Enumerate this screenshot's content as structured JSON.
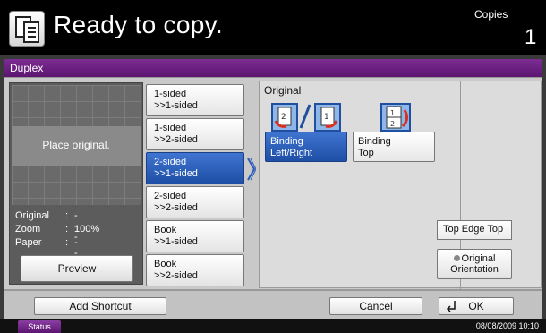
{
  "header": {
    "title": "Ready to copy.",
    "copies_label": "Copies",
    "copies_value": "1",
    "icon": "copy-document-icon"
  },
  "function_bar": {
    "title": "Duplex"
  },
  "preview": {
    "placeholder": "Place original.",
    "original_label": "Original",
    "original_value": "---",
    "zoom_label": "Zoom",
    "zoom_value": "100%",
    "paper_label": "Paper",
    "paper_value": "---",
    "separator": ":",
    "button": "Preview"
  },
  "duplex_options": [
    {
      "label": "1-sided\n>>1-sided",
      "selected": false
    },
    {
      "label": "1-sided\n>>2-sided",
      "selected": false
    },
    {
      "label": "2-sided\n>>1-sided",
      "selected": true
    },
    {
      "label": "2-sided\n>>2-sided",
      "selected": false
    },
    {
      "label": "Book\n>>1-sided",
      "selected": false
    },
    {
      "label": "Book\n>>2-sided",
      "selected": false
    }
  ],
  "original_section": {
    "title": "Original",
    "binding_left_right": "Binding\nLeft/Right",
    "binding_top": "Binding\nTop",
    "selected": "binding_left_right",
    "orientation_label": "Top Edge Top",
    "orientation_button": "Original\nOrientation"
  },
  "bottom": {
    "add_shortcut": "Add Shortcut",
    "cancel": "Cancel",
    "ok": "OK"
  },
  "status": {
    "tab": "Status",
    "datetime": "08/08/2009   10:10"
  },
  "colors": {
    "accent_purple": "#6a1f82",
    "selected_blue": "#2a5bb8",
    "header_black": "#000000"
  }
}
